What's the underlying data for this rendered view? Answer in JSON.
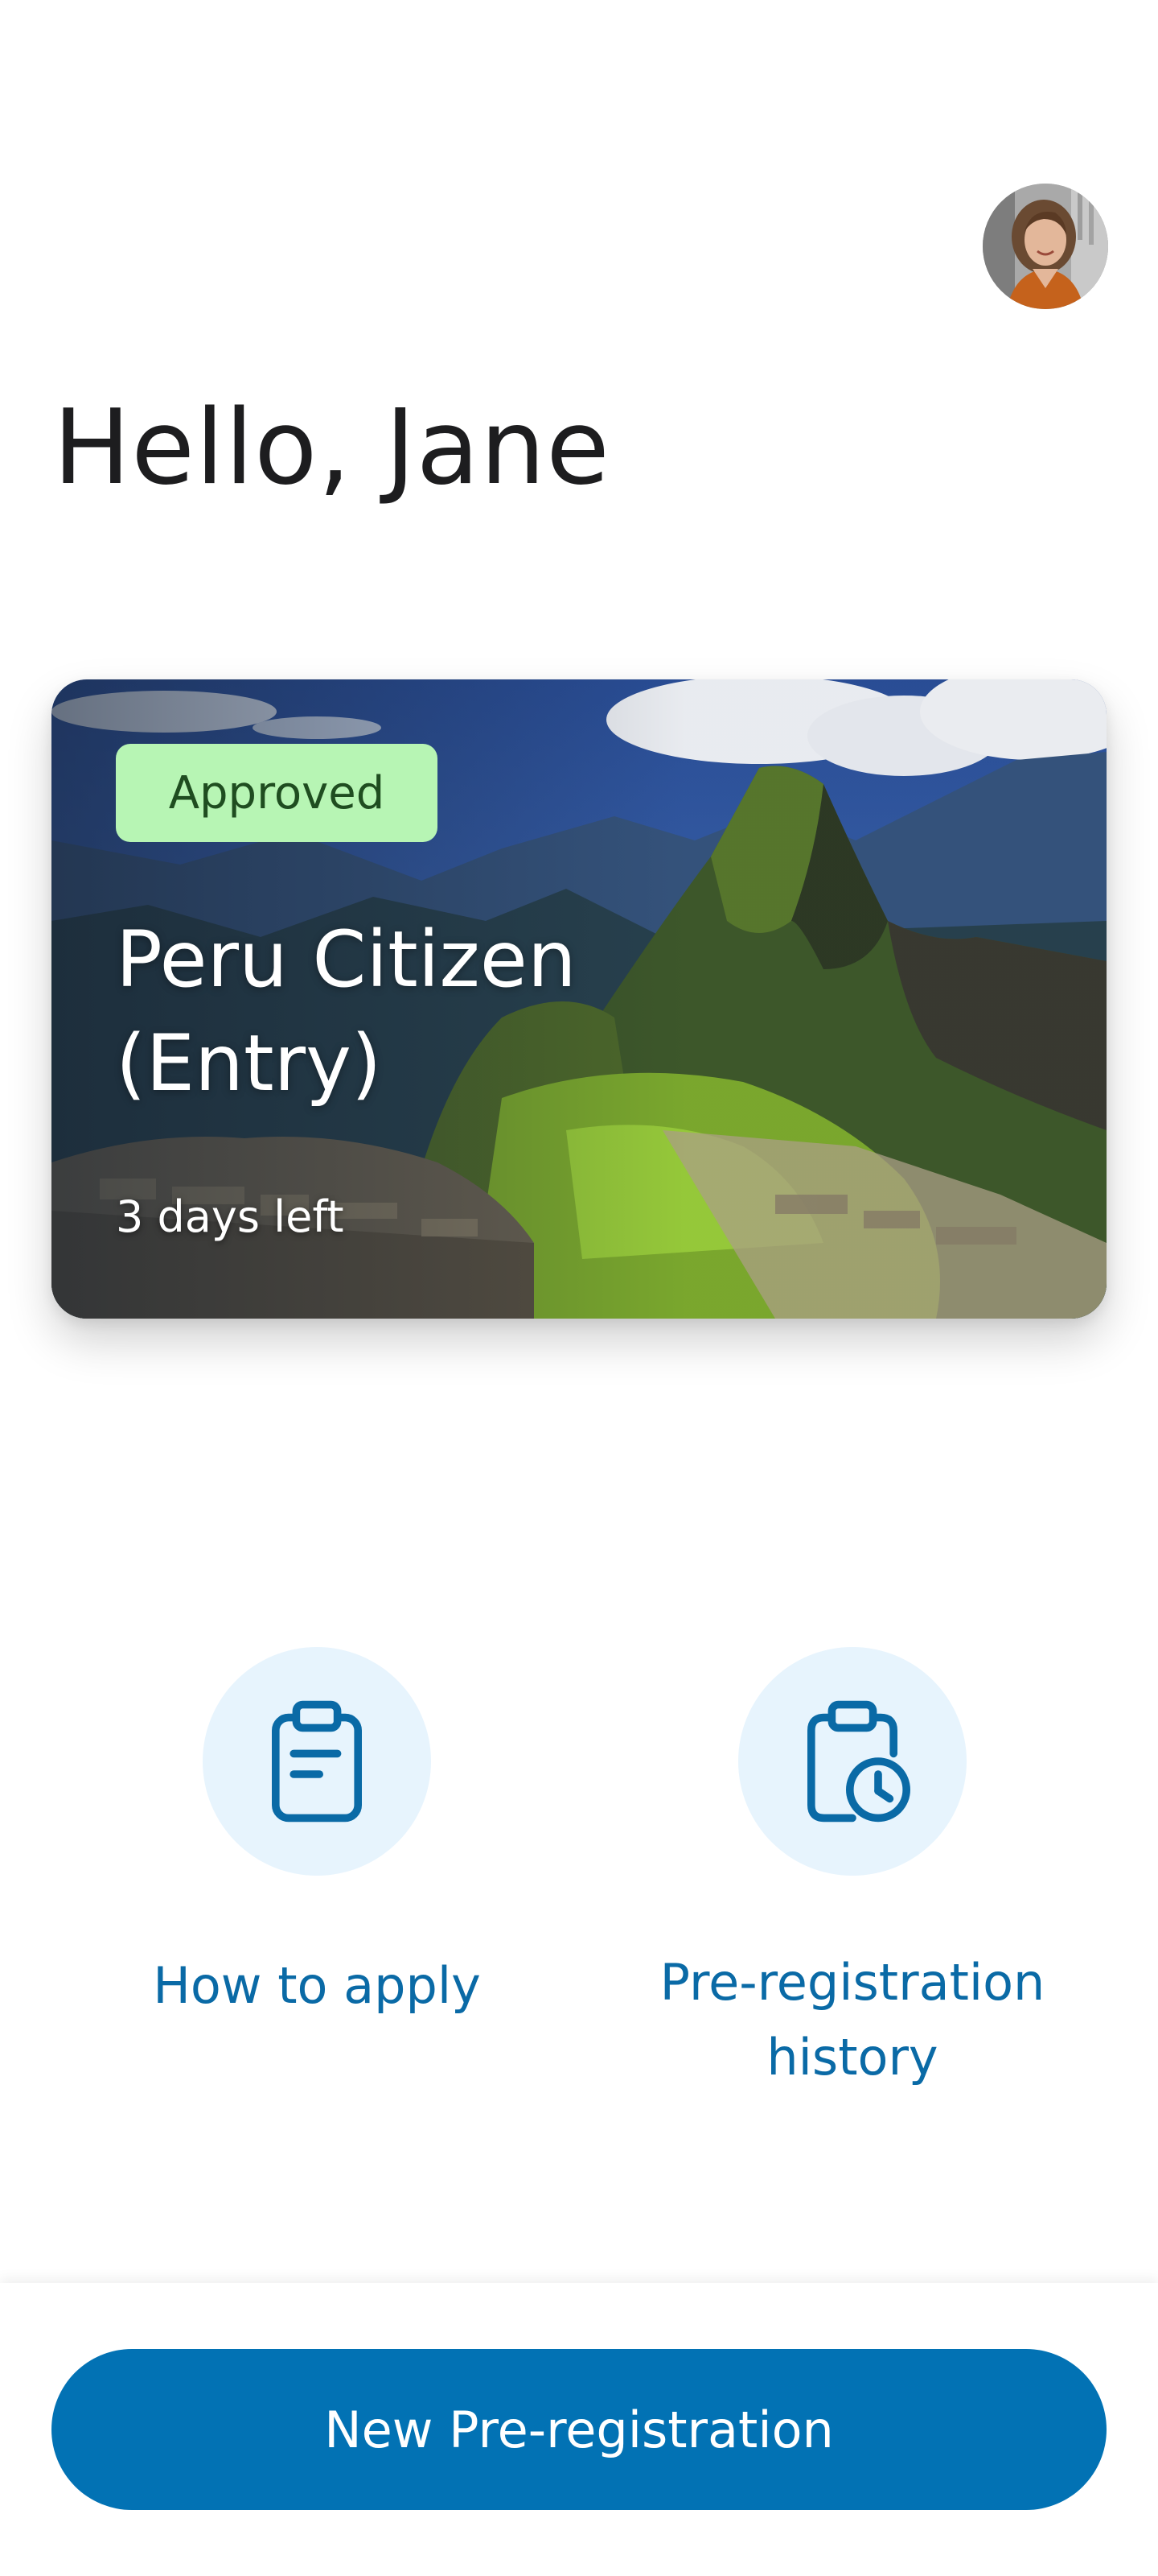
{
  "user": {
    "greeting": "Hello, Jane"
  },
  "card": {
    "status": "Approved",
    "title_line1": "Peru Citizen",
    "title_line2": "(Entry)",
    "days_left": "3 days left",
    "badge_color": "#b7f5b4"
  },
  "actions": [
    {
      "label": "How to apply",
      "icon": "clipboard-icon"
    },
    {
      "label_line1": "Pre-registration",
      "label_line2": "history",
      "icon": "clipboard-clock-icon"
    }
  ],
  "footer": {
    "cta_label": "New Pre-registration"
  },
  "colors": {
    "accent": "#0272b4",
    "action_text": "#0a6aa6",
    "action_bg": "#e7f4fd"
  }
}
